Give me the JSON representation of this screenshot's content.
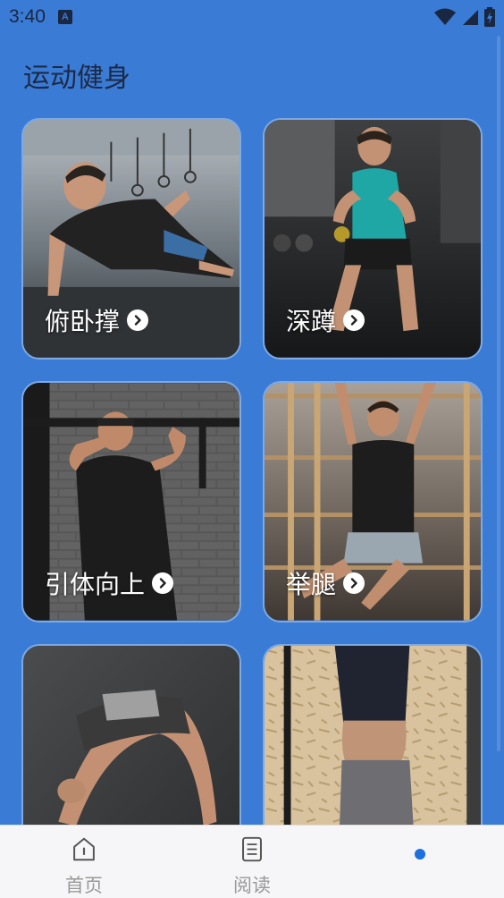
{
  "status": {
    "time": "3:40",
    "notification_badge": "A"
  },
  "page": {
    "title": "运动健身"
  },
  "cards": [
    {
      "label": "俯卧撑",
      "icon": "chevron-right-icon"
    },
    {
      "label": "深蹲",
      "icon": "chevron-right-icon"
    },
    {
      "label": "引体向上",
      "icon": "chevron-right-icon"
    },
    {
      "label": "举腿",
      "icon": "chevron-right-icon"
    },
    {
      "label": "",
      "icon": ""
    },
    {
      "label": "",
      "icon": ""
    }
  ],
  "nav": {
    "items": [
      {
        "label": "首页",
        "icon": "home-icon"
      },
      {
        "label": "阅读",
        "icon": "document-icon"
      },
      {
        "label": "",
        "icon": "active-dot"
      }
    ]
  },
  "colors": {
    "background": "#3a7bd5",
    "title": "#1c2a45",
    "nav_dot": "#1e6fe0"
  }
}
